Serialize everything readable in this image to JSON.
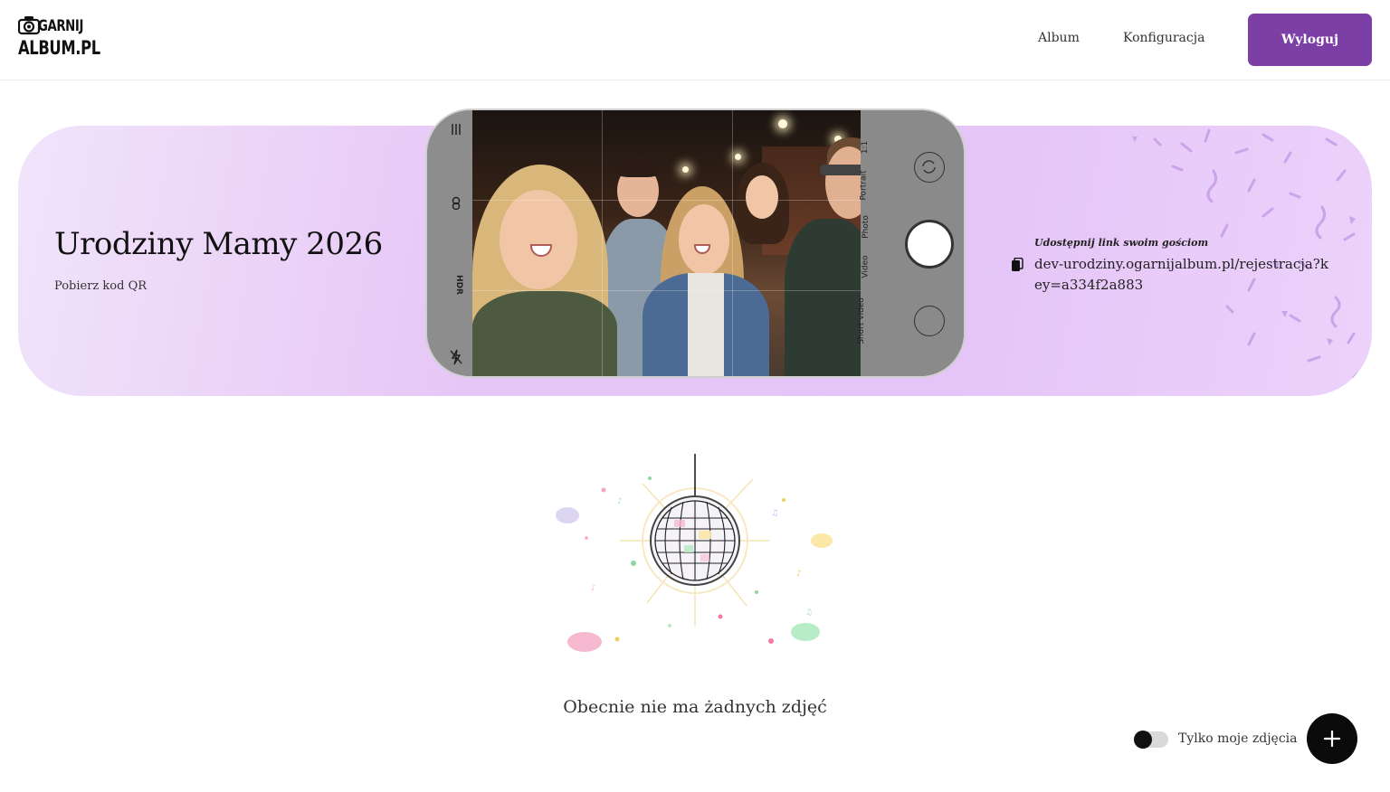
{
  "header": {
    "logo_line1": "GARNIJ",
    "logo_line2": "ALBUM.PL",
    "nav": [
      {
        "label": "Album"
      },
      {
        "label": "Konfiguracja"
      }
    ],
    "logout_label": "Wyloguj"
  },
  "banner": {
    "title": "Urodziny Mamy 2026",
    "qr_label": "Pobierz kod QR",
    "share_label": "Udostępnij link swoim gościom",
    "share_url": "dev-urodziny.ogarnijalbum.pl/rejestracja?key=a334f2a883",
    "phone": {
      "modes": [
        "1:1",
        "Portrait",
        "Photo",
        "Video",
        "Short video"
      ],
      "left_icons": [
        "menu-icon",
        "hdr-icon",
        "flash-off-icon"
      ]
    }
  },
  "empty_state": {
    "message": "Obecnie nie ma żadnych zdjęć"
  },
  "footer_controls": {
    "toggle_label": "Tylko moje zdjęcia",
    "toggle_on": false,
    "add_button_icon": "plus-icon"
  },
  "colors": {
    "accent": "#7b3fa5",
    "banner_bg": "#e6c6f6",
    "fab_bg": "#0b0b0b"
  }
}
